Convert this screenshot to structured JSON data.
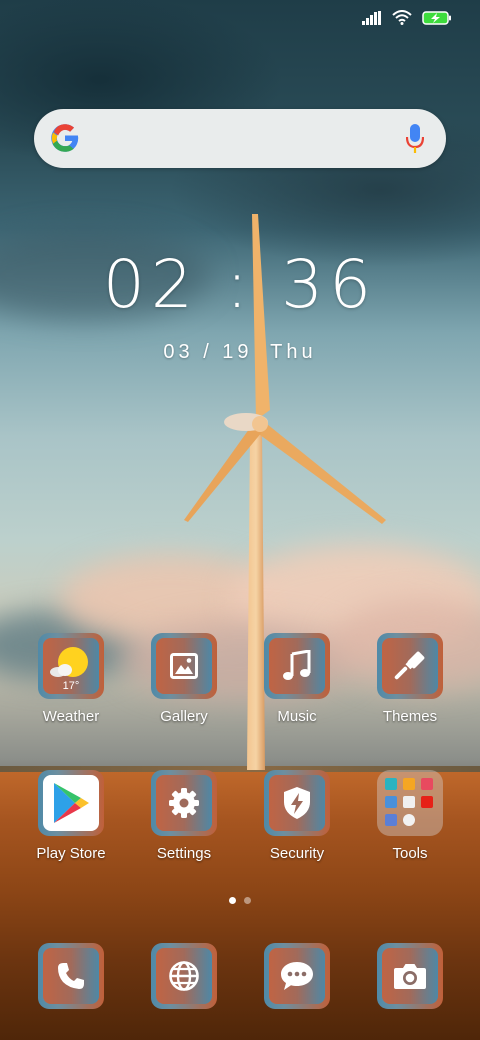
{
  "status_bar": {
    "signal": "signal-full-icon",
    "wifi": "wifi-icon",
    "battery": "battery-charging-icon",
    "battery_color": "#3ddc3d"
  },
  "search": {
    "logo": "google-g-logo",
    "mic": "voice-search-mic-icon"
  },
  "clock": {
    "time": "02 : 36",
    "date": "03 / 19",
    "weekday": "Thu"
  },
  "apps_row1": [
    {
      "label": "Weather",
      "icon": "weather-sun-cloud-icon",
      "temp": "17°"
    },
    {
      "label": "Gallery",
      "icon": "gallery-image-icon"
    },
    {
      "label": "Music",
      "icon": "music-note-icon"
    },
    {
      "label": "Themes",
      "icon": "paintbrush-icon"
    }
  ],
  "apps_row2": [
    {
      "label": "Play Store",
      "icon": "play-store-icon"
    },
    {
      "label": "Settings",
      "icon": "gear-icon"
    },
    {
      "label": "Security",
      "icon": "shield-bolt-icon"
    },
    {
      "label": "Tools",
      "icon": "folder-icon"
    }
  ],
  "page_indicator": {
    "pages": 2,
    "active": 1
  },
  "dock": [
    {
      "name": "phone",
      "icon": "phone-icon"
    },
    {
      "name": "browser",
      "icon": "globe-icon"
    },
    {
      "name": "messages",
      "icon": "chat-bubble-icon"
    },
    {
      "name": "camera",
      "icon": "camera-icon"
    }
  ],
  "colors": {
    "icon_frame_blue": "#4f8aa8",
    "icon_frame_orange": "#c0603a",
    "search_bg": "#e9ecec"
  }
}
